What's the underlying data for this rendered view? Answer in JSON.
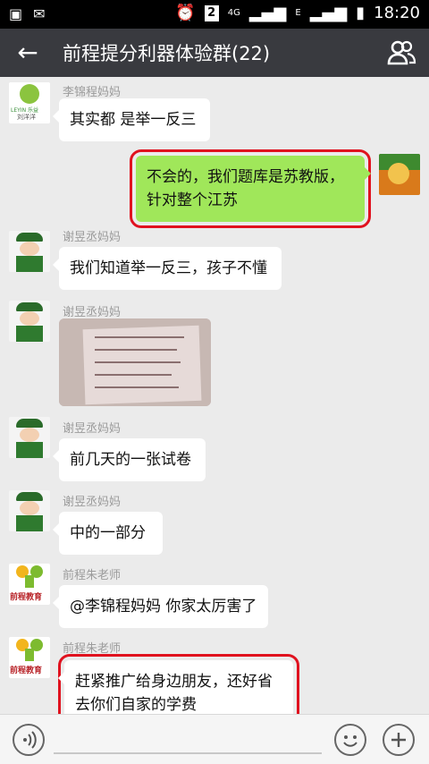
{
  "status_bar": {
    "sim_badge": "2",
    "network": "4G",
    "network_sub": "E",
    "time": "18:20"
  },
  "header": {
    "title": "前程提分利器体验群(22)"
  },
  "messages": [
    {
      "sender": "李锦程妈妈",
      "text": "其实都 是举一反三",
      "side": "left",
      "avatar_text": "刘洋洋",
      "avatar_label": "LEYIN 乐益"
    },
    {
      "sender": "",
      "text": "不会的，我们题库是苏教版，针对整个江苏",
      "side": "right"
    },
    {
      "sender": "谢昱丞妈妈",
      "text": "我们知道举一反三，孩子不懂",
      "side": "left"
    },
    {
      "sender": "谢昱丞妈妈",
      "text": "",
      "side": "left",
      "type": "image"
    },
    {
      "sender": "谢昱丞妈妈",
      "text": "前几天的一张试卷",
      "side": "left"
    },
    {
      "sender": "谢昱丞妈妈",
      "text": "中的一部分",
      "side": "left"
    },
    {
      "sender": "前程朱老师",
      "text": "@李锦程妈妈 你家太厉害了",
      "side": "left",
      "avatar_text": "前程教育"
    },
    {
      "sender": "前程朱老师",
      "text": "赶紧推广给身边朋友，还好省去你们自家的学费",
      "side": "left",
      "avatar_text": "前程教育"
    }
  ],
  "icons": {
    "back": "back-arrow-icon",
    "people": "group-members-icon"
  }
}
